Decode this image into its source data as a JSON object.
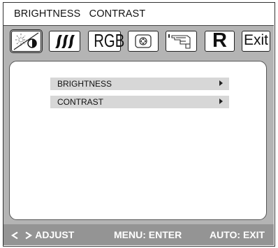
{
  "title": "BRIGHTNESS   CONTRAST",
  "tabs": [
    {
      "name": "brightness-contrast",
      "icon": "sun-half-circle-icon"
    },
    {
      "name": "image",
      "icon": "wavy-lines-icon"
    },
    {
      "name": "color",
      "label": "RGB"
    },
    {
      "name": "position",
      "icon": "screen-position-icon"
    },
    {
      "name": "osd-setup",
      "icon": "hand-pointer-icon"
    },
    {
      "name": "reset",
      "label": "R"
    },
    {
      "name": "exit",
      "label": "Exit"
    }
  ],
  "menu": {
    "items": [
      {
        "label": "BRIGHTNESS",
        "arrow": "right-triangle-icon"
      },
      {
        "label": "CONTRAST",
        "arrow": "right-triangle-icon"
      }
    ]
  },
  "footer": {
    "adjust": "ADJUST",
    "menu": "MENU: ENTER",
    "auto": "AUTO: EXIT",
    "icons": [
      "left-arrow-icon",
      "right-arrow-icon"
    ]
  },
  "colors": {
    "frame_gray": "#b4b4b4",
    "footer_gray": "#949494",
    "menu_item_gray": "#d7d7d7",
    "text": "#111111"
  }
}
